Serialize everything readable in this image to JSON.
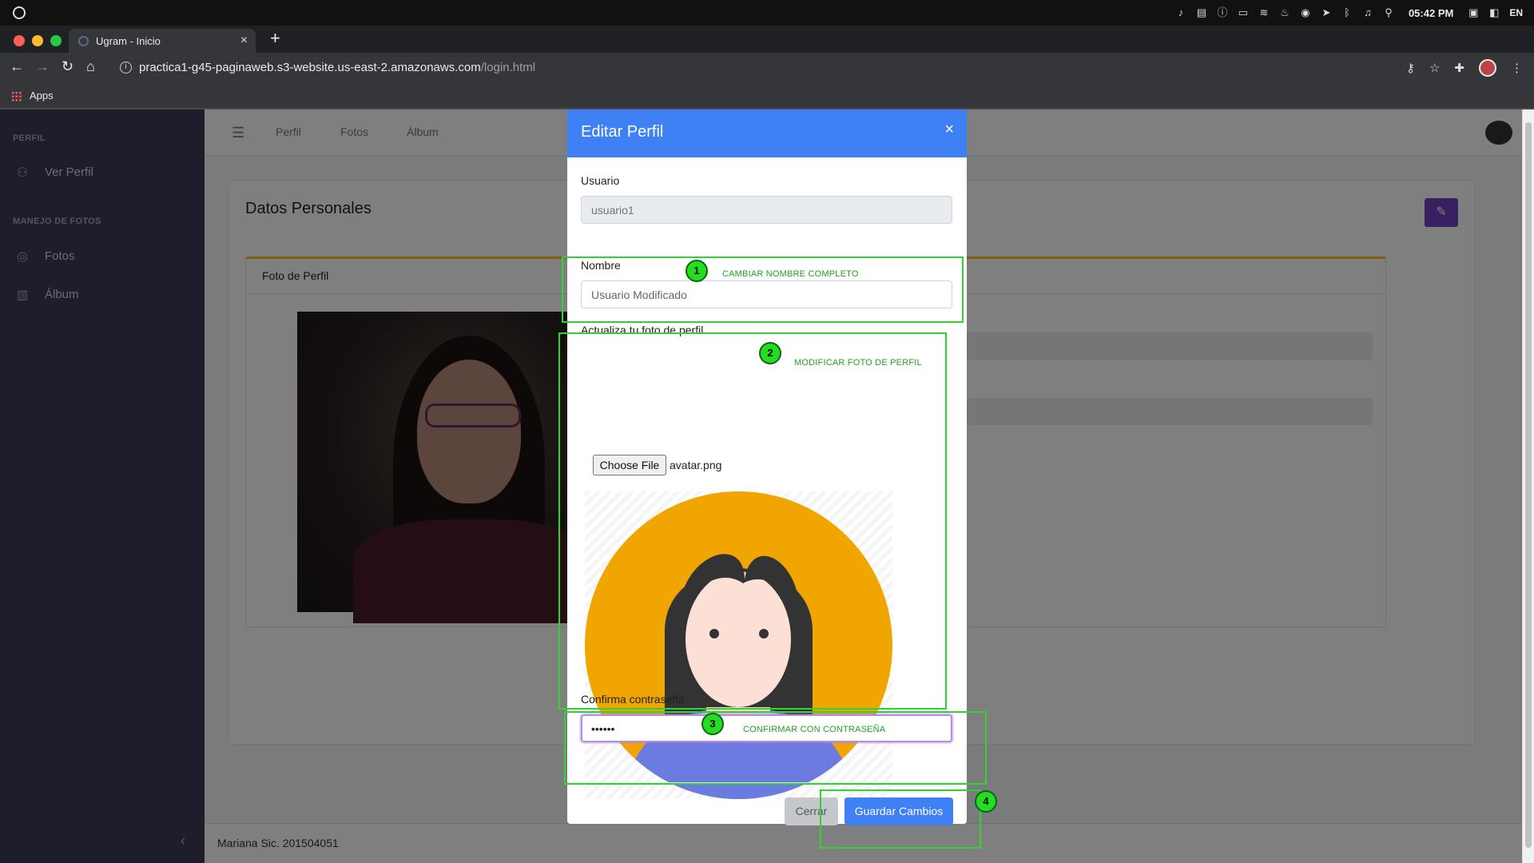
{
  "os": {
    "clock": "05:42 PM",
    "lang": "EN",
    "tray_icons": [
      "bell-icon",
      "clipboard-icon",
      "info-icon",
      "battery-icon",
      "wifi-icon",
      "flame-icon",
      "discord-icon",
      "telegram-icon",
      "bluetooth-icon",
      "volume-icon",
      "search-icon"
    ]
  },
  "browser": {
    "tab_title": "Ugram - Inicio",
    "url_host": "practica1-g45-paginaweb.s3-website.us-east-2.amazonaws.com",
    "url_path": "/login.html",
    "bookmark_apps": "Apps"
  },
  "sidebar": {
    "section_perfil": "PERFIL",
    "item_ver_perfil": "Ver Perfil",
    "section_fotos": "MANEJO DE FOTOS",
    "item_fotos": "Fotos",
    "item_album": "Álbum"
  },
  "topnav": {
    "links": [
      "Perfil",
      "Fotos",
      "Álbum"
    ]
  },
  "card": {
    "title": "Datos Personales",
    "sub_header": "Foto de Perfil"
  },
  "footer": {
    "text": "Mariana Sic. 201504051"
  },
  "modal": {
    "title": "Editar Perfil",
    "usuario_label": "Usuario",
    "usuario_value": "usuario1",
    "nombre_label": "Nombre",
    "nombre_value": "Usuario Modificado",
    "foto_label": "Actualiza tu foto de perfil",
    "choose_file": "Choose File",
    "file_name": "avatar.png",
    "password_label": "Confirma contraseña",
    "password_value": "••••••",
    "btn_cerrar": "Cerrar",
    "btn_guardar": "Guardar Cambios"
  },
  "annotations": [
    {
      "num": "1",
      "text": "CAMBIAR NOMBRE COMPLETO"
    },
    {
      "num": "2",
      "text": "MODIFICAR FOTO DE PERFIL"
    },
    {
      "num": "3",
      "text": "CONFIRMAR CON CONTRASEÑA"
    },
    {
      "num": "4",
      "text": ""
    }
  ],
  "colors": {
    "modal_header": "#3f80f4",
    "sidebar": "#3b3b57",
    "annotation_green": "#32d232",
    "edit_button": "#6f42c1"
  }
}
